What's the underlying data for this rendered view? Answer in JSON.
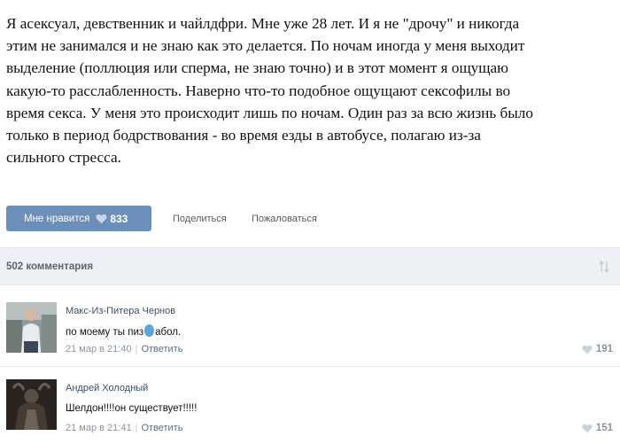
{
  "post": {
    "lines": [
      "Я асексуал, девственник и чайлдфри. Мне уже 28 лет. И я не \"дрочу\" и никогда",
      "этим не занимался и не знаю как это делается. По ночам иногда у меня выходит",
      "выделение (поллюция или сперма, не знаю точно) и в этот момент я ощущаю",
      "какую-то расслабленность. Наверно что-то подобное ощущают сексофилы во",
      "время секса. У меня это происходит лишь по ночам. Один раз за всю жизнь было",
      "только в период бодрствования - во время езды в автобусе, полагаю из-за",
      "сильного стресса."
    ]
  },
  "actions": {
    "like_label": "Мне нравится",
    "like_count": "833",
    "share_label": "Поделиться",
    "report_label": "Пожаловаться"
  },
  "comments_header": {
    "count_label": "502 комментария",
    "sort_icon": "sort-arrows-icon"
  },
  "comments": [
    {
      "author": "Макс-Из-Питера Чернов",
      "text_before": "по моему ты пиз",
      "text_after": "абол.",
      "date": "21 мар в 21:40",
      "reply_label": "Ответить",
      "likes": "191"
    },
    {
      "author": "Андрей Холодный",
      "text": "Шелдон!!!!он существует!!!!!",
      "date": "21 мар в 21:41",
      "reply_label": "Ответить",
      "likes": "151"
    }
  ],
  "colors": {
    "like_button": "#6b8fb8",
    "comments_bar": "#edf0f4",
    "author_link": "#3d4f66",
    "censor_blob": "#5da4d8"
  }
}
